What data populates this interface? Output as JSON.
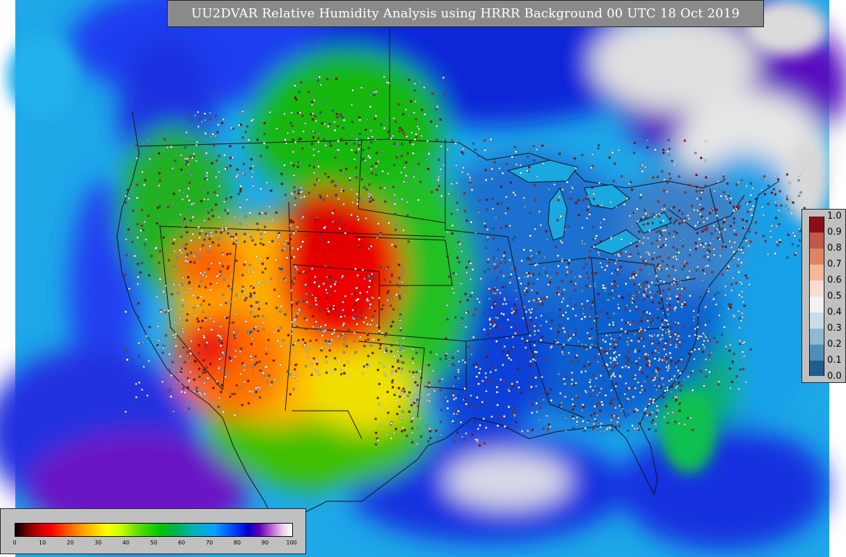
{
  "title": "UU2DVAR Relative Humidity Analysis using HRRR Background 00 UTC 18 Oct 2019",
  "station_legend": {
    "labels": [
      "1.0",
      "0.9",
      "0.8",
      "0.7",
      "0.6",
      "0.5",
      "0.4",
      "0.3",
      "0.2",
      "0.1",
      "0.0"
    ],
    "colors": [
      "#8b0f16",
      "#b2232a",
      "#c2584a",
      "#dd8463",
      "#f5b89b",
      "#f7ddd2",
      "#f2f2f2",
      "#c9dde8",
      "#8fb9cf",
      "#4f8fb5",
      "#1f5d90",
      "#0b2e5c"
    ]
  },
  "colorbar": {
    "ticks": [
      "0",
      "10",
      "20",
      "30",
      "40",
      "50",
      "60",
      "70",
      "80",
      "90",
      "100"
    ]
  },
  "colors": {
    "ocean_far": "#19a6e6",
    "land_dry": "#e60000",
    "land_mid": "#00c800",
    "land_humid": "#0000dc",
    "cloud": "#dcdcdc",
    "border": "#111111"
  }
}
